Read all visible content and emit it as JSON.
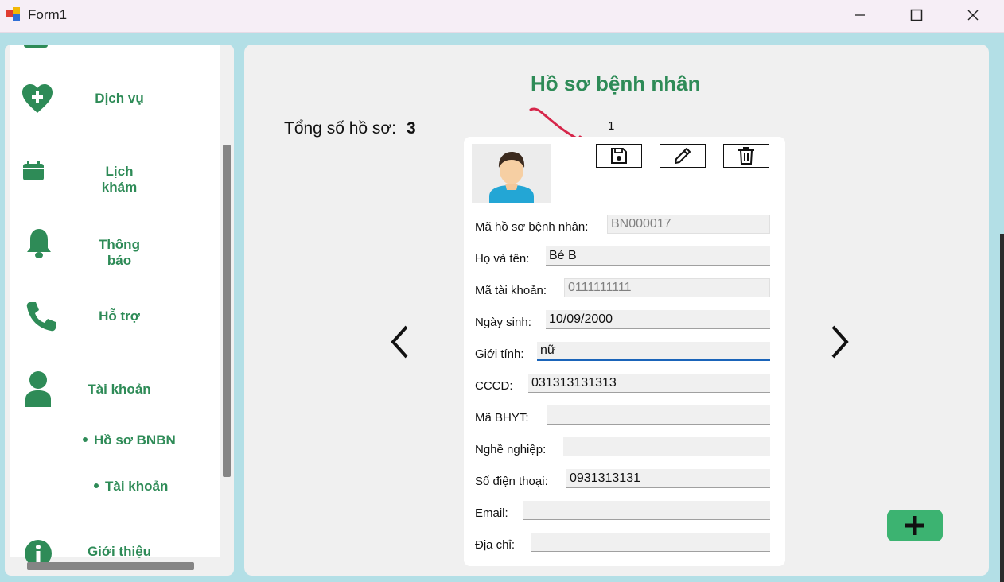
{
  "window": {
    "title": "Form1"
  },
  "sidebar": {
    "items": [
      {
        "label": "Dịch vụ",
        "icon": "heart-plus-icon"
      },
      {
        "label": "Lịch khám",
        "icon": "calendar-icon"
      },
      {
        "label": "Thông báo",
        "icon": "bell-icon"
      },
      {
        "label": "Hỗ trợ",
        "icon": "phone-icon"
      },
      {
        "label": "Tài khoản",
        "icon": "user-icon"
      },
      {
        "label": "Giới thiệu",
        "icon": "info-icon"
      }
    ],
    "subitems": [
      {
        "label": "Hồ sơ BNBN"
      },
      {
        "label": "Tài khoản"
      }
    ]
  },
  "main": {
    "title": "Hồ sơ bệnh nhân",
    "total_label": "Tổng số hồ sơ:",
    "total_value": "3",
    "record_index": "1",
    "fields": [
      {
        "label": "Mã hồ sơ bệnh nhân:",
        "value": "BN000017",
        "readonly": true
      },
      {
        "label": "Họ và tên:",
        "value": "Bé B"
      },
      {
        "label": "Mã tài khoản:",
        "value": "0111111111",
        "readonly": true
      },
      {
        "label": "Ngày sinh:",
        "value": "10/09/2000"
      },
      {
        "label": "Giới tính:",
        "value": "nữ",
        "focused": true
      },
      {
        "label": "CCCD:",
        "value": "031313131313"
      },
      {
        "label": "Mã BHYT:",
        "value": ""
      },
      {
        "label": "Nghề nghiệp:",
        "value": ""
      },
      {
        "label": "Số điện thoại:",
        "value": "0931313131"
      },
      {
        "label": "Email:",
        "value": ""
      },
      {
        "label": "Địa chỉ:",
        "value": ""
      }
    ]
  },
  "colors": {
    "accent": "#2e8b57",
    "add_button": "#3cb371",
    "annotation_arrow": "#d6264a"
  }
}
